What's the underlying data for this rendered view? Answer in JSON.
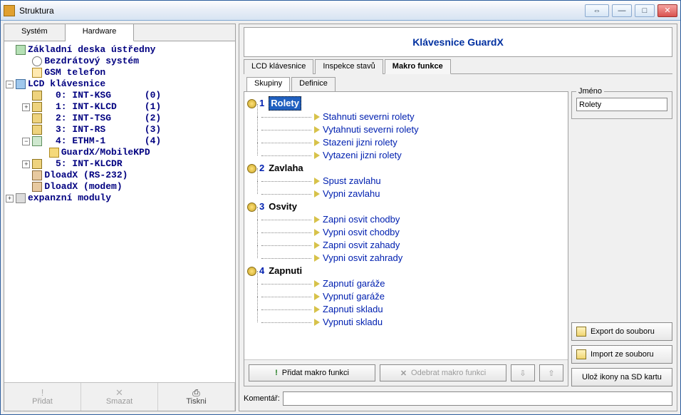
{
  "window": {
    "title": "Struktura",
    "double_arrow_glyph": "⇔",
    "minimize_glyph": "—",
    "maximize_glyph": "□",
    "close_glyph": "✕"
  },
  "left_tabs": {
    "system": "Systém",
    "hardware": "Hardware"
  },
  "tree": [
    {
      "indent": 0,
      "exp": "",
      "iconClass": "",
      "label": "Základní deska ústředny"
    },
    {
      "indent": 1,
      "exp": "",
      "iconClass": "wifi",
      "label": "Bezdrátový systém"
    },
    {
      "indent": 1,
      "exp": "",
      "iconClass": "gsm",
      "label": "GSM telefon"
    },
    {
      "indent": 0,
      "exp": "-",
      "iconClass": "lcd",
      "label": "LCD klávesnice"
    },
    {
      "indent": 1,
      "exp": "",
      "iconClass": "kpd",
      "label": "  0: INT-KSG      (0)"
    },
    {
      "indent": 1,
      "exp": "+",
      "iconClass": "kpd",
      "label": "  1: INT-KLCD     (1)"
    },
    {
      "indent": 1,
      "exp": "",
      "iconClass": "kpd",
      "label": "  2: INT-TSG      (2)"
    },
    {
      "indent": 1,
      "exp": "",
      "iconClass": "kpd",
      "label": "  3: INT-RS       (3)"
    },
    {
      "indent": 1,
      "exp": "-",
      "iconClass": "net",
      "label": "  4: ETHM-1       (4)"
    },
    {
      "indent": 2,
      "exp": "",
      "iconClass": "guardx",
      "label": "GuardX/MobileKPD"
    },
    {
      "indent": 1,
      "exp": "+",
      "iconClass": "kpd",
      "label": "  5: INT-KLCDR"
    },
    {
      "indent": 1,
      "exp": "",
      "iconClass": "dload",
      "label": "DloadX (RS-232)"
    },
    {
      "indent": 1,
      "exp": "",
      "iconClass": "dload",
      "label": "DloadX (modem)"
    },
    {
      "indent": 0,
      "exp": "+",
      "iconClass": "exp",
      "label": "expanzní moduly"
    }
  ],
  "left_bottom": {
    "add": "Přidat",
    "add_glyph": "!",
    "delete": "Smazat",
    "delete_glyph": "✕",
    "print": "Tiskni",
    "print_glyph": "⎙"
  },
  "right": {
    "header": "Klávesnice GuardX",
    "mid_tabs": {
      "lcd": "LCD klávesnice",
      "inspect": "Inspekce stavů",
      "macro": "Makro funkce"
    },
    "sub_tabs": {
      "groups": "Skupiny",
      "defs": "Definice"
    },
    "groups": [
      {
        "num": "1",
        "name": "Rolety",
        "selected": true,
        "items": [
          "Stahnuti severni rolety",
          "Vytahnuti severni rolety",
          "Stazeni jizni rolety",
          "Vytazeni jizni rolety"
        ]
      },
      {
        "num": "2",
        "name": "Zavlaha",
        "selected": false,
        "items": [
          "Spust zavlahu",
          "Vypni zavlahu"
        ]
      },
      {
        "num": "3",
        "name": "Osvity",
        "selected": false,
        "items": [
          "Zapni osvit chodby",
          "Vypni osvit chodby",
          "Zapni osvit zahady",
          "Vypni osvit zahrady"
        ]
      },
      {
        "num": "4",
        "name": "Zapnuti",
        "selected": false,
        "items": [
          "Zapnutí garáže",
          "Vypnutí garáže",
          "Zapnuti skladu",
          "Vypnuti skladu"
        ]
      }
    ],
    "buttons": {
      "add_macro": "Přidat makro funkci",
      "add_glyph": "!",
      "remove_macro": "Odebrat makro funkci",
      "remove_glyph": "✕",
      "down_glyph": "⇩",
      "up_glyph": "⇧"
    },
    "sidebar": {
      "name_legend": "Jméno",
      "name_value": "Rolety",
      "export": "Export do souboru",
      "import": "Import ze souboru",
      "save_sd": "Ulož ikony na SD kartu"
    },
    "comment_label": "Komentář:",
    "comment_value": ""
  }
}
